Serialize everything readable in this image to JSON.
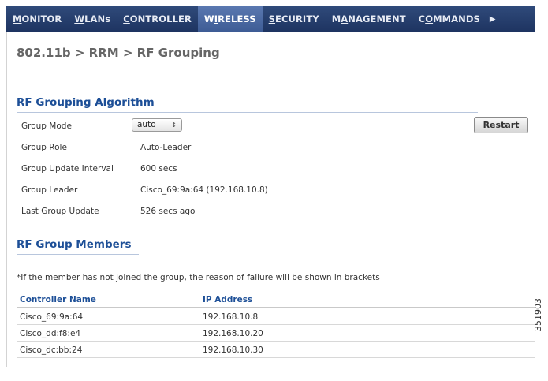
{
  "nav": {
    "items": [
      {
        "pre": "",
        "ul": "M",
        "post": "ONITOR",
        "active": false
      },
      {
        "pre": "",
        "ul": "W",
        "post": "LANs",
        "active": false
      },
      {
        "pre": "",
        "ul": "C",
        "post": "ONTROLLER",
        "active": false
      },
      {
        "pre": "W",
        "ul": "I",
        "post": "RELESS",
        "active": true
      },
      {
        "pre": "",
        "ul": "S",
        "post": "ECURITY",
        "active": false
      },
      {
        "pre": "M",
        "ul": "A",
        "post": "NAGEMENT",
        "active": false
      },
      {
        "pre": "C",
        "ul": "O",
        "post": "MMANDS",
        "active": false
      }
    ],
    "more_icon": "chevron-right-icon"
  },
  "breadcrumb": "802.11b > RRM > RF Grouping",
  "algorithm": {
    "title": "RF Grouping Algorithm",
    "group_mode_label": "Group Mode",
    "group_mode_value": "auto",
    "group_role_label": "Group Role",
    "group_role_value": "Auto-Leader",
    "update_interval_label": "Group Update Interval",
    "update_interval_value": "600 secs",
    "group_leader_label": "Group Leader",
    "group_leader_value": "Cisco_69:9a:64 (192.168.10.8)",
    "last_update_label": "Last Group Update",
    "last_update_value": "526 secs ago",
    "restart_label": "Restart"
  },
  "members": {
    "title": "RF Group Members",
    "note": "*If the member has not joined the group, the reason of failure will be shown in brackets",
    "columns": [
      "Controller Name",
      "IP Address"
    ],
    "rows": [
      {
        "name": "Cisco_69:9a:64",
        "ip": "192.168.10.8"
      },
      {
        "name": "Cisco_dd:f8:e4",
        "ip": "192.168.10.20"
      },
      {
        "name": "Cisco_dc:bb:24",
        "ip": "192.168.10.30"
      }
    ]
  },
  "figure_id": "351903",
  "colors": {
    "nav_bg": "#1e3461",
    "section_title": "#1d4f97"
  }
}
